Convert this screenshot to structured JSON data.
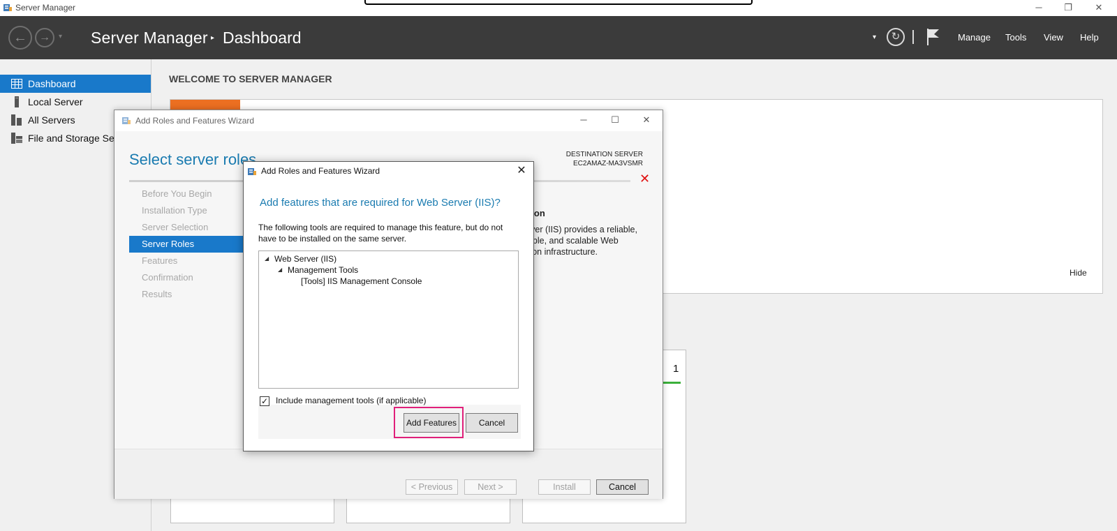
{
  "window": {
    "title": "Server Manager",
    "controls": {
      "minimize": "─",
      "restore": "❐",
      "close": "✕"
    }
  },
  "header": {
    "app_name": "Server Manager",
    "separator": "▸",
    "page": "Dashboard",
    "back": "←",
    "forward": "→",
    "nav_dropdown": "▾",
    "notifications_dropdown": "▾",
    "refresh": "↻",
    "menus": [
      "Manage",
      "Tools",
      "View",
      "Help"
    ]
  },
  "sidebar": {
    "items": [
      {
        "label": "Dashboard",
        "icon": "dashboard-icon",
        "active": true
      },
      {
        "label": "Local Server",
        "icon": "server-icon",
        "active": false
      },
      {
        "label": "All Servers",
        "icon": "servers-icon",
        "active": false
      },
      {
        "label": "File and Storage Services",
        "icon": "storage-icon",
        "active": false
      }
    ]
  },
  "main": {
    "welcome": "WELCOME TO SERVER MANAGER",
    "hide": "Hide",
    "tile_count": "1"
  },
  "wizard": {
    "title": "Add Roles and Features Wizard",
    "heading": "Select server roles",
    "destination_label": "DESTINATION SERVER",
    "destination_server": "EC2AMAZ-MA3VSMR",
    "steps": [
      {
        "label": "Before You Begin",
        "active": false
      },
      {
        "label": "Installation Type",
        "active": false
      },
      {
        "label": "Server Selection",
        "active": false
      },
      {
        "label": "Server Roles",
        "active": true
      },
      {
        "label": "Features",
        "active": false
      },
      {
        "label": "Confirmation",
        "active": false
      },
      {
        "label": "Results",
        "active": false
      }
    ],
    "description_title": "ption",
    "description_lines": [
      "erver (IIS) provides a reliable,",
      "eable, and scalable Web",
      "ation infrastructure."
    ],
    "buttons": {
      "previous": "< Previous",
      "next": "Next >",
      "install": "Install",
      "cancel": "Cancel"
    },
    "error_icon": "✕"
  },
  "dialog": {
    "title": "Add Roles and Features Wizard",
    "close": "✕",
    "heading": "Add features that are required for Web Server (IIS)?",
    "text": "The following tools are required to manage this feature, but do not have to be installed on the same server.",
    "tree": [
      {
        "label": "Web Server (IIS)",
        "level": 0,
        "expanded": true
      },
      {
        "label": "Management Tools",
        "level": 1,
        "expanded": true
      },
      {
        "label": "[Tools] IIS Management Console",
        "level": 2,
        "expanded": false
      }
    ],
    "checkbox_label": "Include management tools (if applicable)",
    "checkbox_checked": true,
    "check_mark": "✓",
    "buttons": {
      "add_features": "Add Features",
      "cancel": "Cancel"
    }
  },
  "colors": {
    "header_bg": "#3b3b3b",
    "accent_blue": "#1979ca",
    "heading_blue": "#1a7bb0",
    "highlight_pink": "#e0207a",
    "orange": "#ec6f21",
    "green": "#3bb03b"
  }
}
